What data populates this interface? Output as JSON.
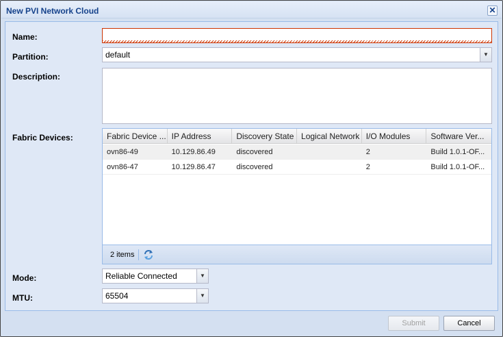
{
  "window": {
    "title": "New PVI Network Cloud",
    "close_glyph": "✕"
  },
  "form": {
    "name_label": "Name:",
    "name_value": "",
    "partition_label": "Partition:",
    "partition_value": "default",
    "description_label": "Description:",
    "description_value": "",
    "fabric_label": "Fabric Devices:",
    "mode_label": "Mode:",
    "mode_value": "Reliable Connected",
    "mtu_label": "MTU:",
    "mtu_value": "65504"
  },
  "grid": {
    "columns": [
      "Fabric Device ...",
      "IP Address",
      "Discovery State",
      "Logical Network",
      "I/O Modules",
      "Software Ver..."
    ],
    "rows": [
      [
        "ovn86-49",
        "10.129.86.49",
        "discovered",
        "",
        "2",
        "Build 1.0.1-OF..."
      ],
      [
        "ovn86-47",
        "10.129.86.47",
        "discovered",
        "",
        "2",
        "Build 1.0.1-OF..."
      ]
    ],
    "items_count": "2 items"
  },
  "buttons": {
    "submit": "Submit",
    "cancel": "Cancel"
  },
  "icons": {
    "close": "close-icon",
    "dropdown": "chevron-down-icon",
    "refresh": "refresh-icon"
  },
  "colors": {
    "title_text": "#15428b",
    "invalid_border": "#cc3300",
    "panel_bg": "#dfe8f6"
  }
}
